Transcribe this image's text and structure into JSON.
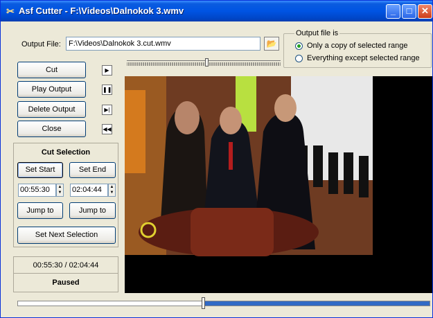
{
  "window": {
    "title": "Asf Cutter - F:\\Videos\\Dalnokok 3.wmv",
    "app_icon": "scissors-icon",
    "minimize_glyph": "_",
    "maximize_glyph": "□",
    "close_glyph": "✕"
  },
  "output": {
    "label": "Output File:",
    "path": "F:\\Videos\\Dalnokok 3.cut.wmv",
    "browse_icon": "folder-open-icon",
    "browse_glyph": "📂"
  },
  "output_mode": {
    "title": "Output file is",
    "options": [
      {
        "label": "Only a copy of selected range",
        "selected": true
      },
      {
        "label": "Everything except selected range",
        "selected": false
      }
    ]
  },
  "actions": {
    "cut": "Cut",
    "play_output": "Play Output",
    "delete_output": "Delete Output",
    "close": "Close"
  },
  "transport_icons": [
    {
      "name": "play-icon",
      "glyph": "▶"
    },
    {
      "name": "pause-icon",
      "glyph": "❚❚"
    },
    {
      "name": "next-frame-icon",
      "glyph": "▶|"
    },
    {
      "name": "previous-frame-icon",
      "glyph": "◀◀"
    }
  ],
  "cut_selection": {
    "title": "Cut Selection",
    "set_start": "Set Start",
    "set_end": "Set End",
    "start_time": "00:55:30",
    "end_time": "02:04:44",
    "jump_to": "Jump to",
    "set_next": "Set Next Selection"
  },
  "status": {
    "time": "00:55:30 / 02:04:44",
    "state": "Paused"
  },
  "seek": {
    "position_fraction": 0.45,
    "selection_start_fraction": 0.45,
    "selection_end_fraction": 1.0,
    "selection_color": "#316ac5"
  },
  "range_slider": {
    "start_fraction": 0.51,
    "end_fraction": 1.0
  }
}
